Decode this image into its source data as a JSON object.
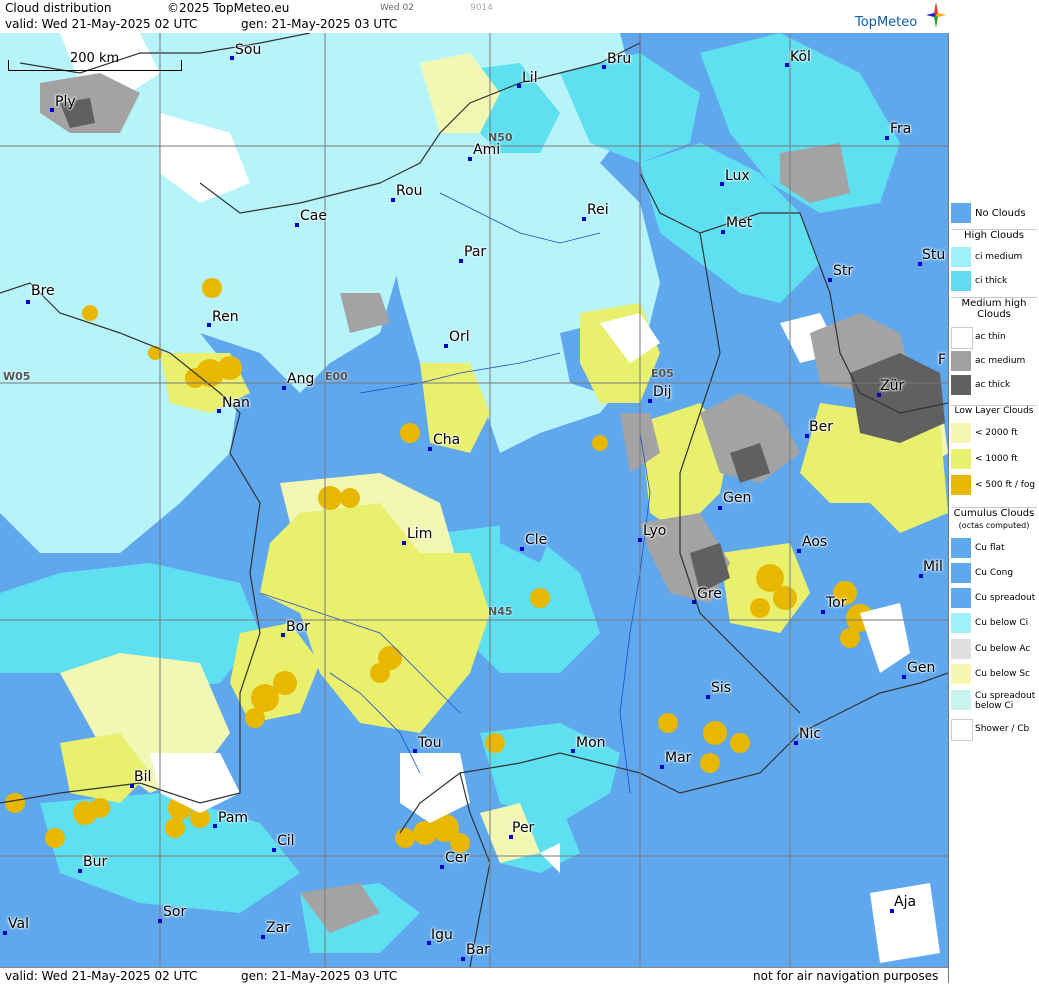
{
  "header": {
    "title": "Cloud distribution",
    "copyright": "©2025 TopMeteo.eu",
    "day_code": "Wed 02",
    "code": "9014",
    "valid_line": "valid:  Wed  21-May-2025  02 UTC",
    "gen_line": "gen: 21-May-2025 03 UTC",
    "brand": "TopMeteo"
  },
  "footer": {
    "valid_line": "valid:  Wed  21-May-2025  02 UTC",
    "gen_line": "gen: 21-May-2025 03 UTC",
    "disclaimer": "not for air navigation purposes"
  },
  "scale": {
    "label": "200 km"
  },
  "grid_labels": {
    "n50": "N50",
    "n45": "N45",
    "w05": "W05",
    "e00": "E00",
    "e05": "E05"
  },
  "cities": {
    "sou": "Sou",
    "ply": "Ply",
    "lil": "Lil",
    "bru": "Bru",
    "kol": "Köl",
    "fra": "Fra",
    "ami": "Ami",
    "rou": "Rou",
    "cae": "Cae",
    "lux": "Lux",
    "rei": "Rei",
    "met": "Met",
    "par": "Par",
    "stu": "Stu",
    "str": "Str",
    "bre": "Bre",
    "ren": "Ren",
    "orl": "Orl",
    "ang": "Ang",
    "nan": "Nan",
    "dij": "Dij",
    "zur": "Zür",
    "cha": "Cha",
    "ber": "Ber",
    "gen": "Gen",
    "lim": "Lim",
    "cle": "Cle",
    "lyo": "Lyo",
    "aos": "Aos",
    "mil": "Mil",
    "gre": "Gre",
    "tor": "Tor",
    "bor": "Bor",
    "sis": "Sis",
    "gen2": "Gen",
    "tou": "Tou",
    "mon": "Mon",
    "mar": "Mar",
    "nic": "Nic",
    "bil": "Bil",
    "pam": "Pam",
    "per": "Per",
    "cil": "Cil",
    "cer": "Cer",
    "bur": "Bur",
    "sor": "Sor",
    "zar": "Zar",
    "igu": "Igu",
    "val": "Val",
    "bar": "Bar",
    "aja": "Aja",
    "f": "F"
  },
  "legend": {
    "no_clouds": "No Clouds",
    "high_clouds": "High Clouds",
    "ci_medium": "ci medium",
    "ci_thick": "ci thick",
    "medium_high": "Medium high Clouds",
    "ac_thin": "ac thin",
    "ac_medium": "ac medium",
    "ac_thick": "ac thick",
    "low_layer": "Low Layer Clouds",
    "lt2000": "< 2000 ft",
    "lt1000": "< 1000 ft",
    "lt500": "< 500 ft / fog",
    "cumulus": "Cumulus Clouds",
    "octas": "(octas computed)",
    "cu_flat": "Cu flat",
    "cu_cong": "Cu Cong",
    "cu_spreadout": "Cu spreadout",
    "cu_below_ci": "Cu below Ci",
    "cu_below_ac": "Cu below Ac",
    "cu_below_sc": "Cu below Sc",
    "cu_spread_below_ci": "Cu spreadout below Ci",
    "shower_cb": "Shower / Cb"
  },
  "colors": {
    "no_clouds": "#5fa8ee",
    "ci_medium": "#9ff0f8",
    "ci_thick": "#60dcf0",
    "ac_thin": "#ffffff",
    "ac_medium": "#a0a0a0",
    "ac_thick": "#606060",
    "lt2000": "#f4f8b0",
    "lt1000": "#e8f070",
    "lt500": "#e8b800"
  }
}
